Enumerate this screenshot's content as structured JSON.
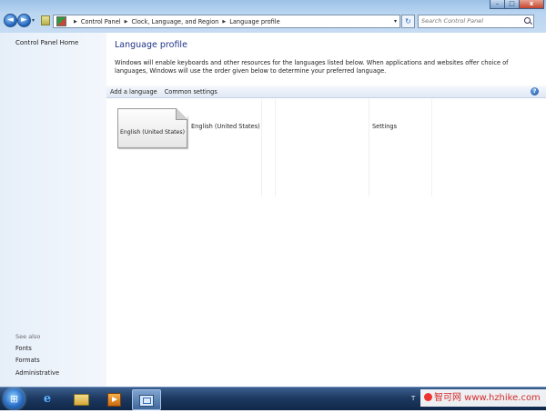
{
  "address_bar": {
    "crumbs": [
      "Control Panel",
      "Clock, Language, and Region",
      "Language profile"
    ],
    "back_glyph": "◄",
    "forward_glyph": "►",
    "dropdown_glyph": "▾",
    "refresh_glyph": "↻"
  },
  "search": {
    "placeholder": "Search Control Panel"
  },
  "window_buttons": {
    "minimize": "–",
    "maximize": "□",
    "close": "x"
  },
  "left_pane": {
    "home_link": "Control Panel Home",
    "see_also_heading": "See also",
    "see_also_links": [
      "Fonts",
      "Formats",
      "Administrative"
    ]
  },
  "main": {
    "title": "Language profile",
    "description": "Windows will enable keyboards and other resources for the languages listed below. When applications and websites offer choice of languages, Windows will use the order given below to determine your preferred language.",
    "toolbar": {
      "add_language": "Add a language",
      "common_settings": "Common settings",
      "help_glyph": "?"
    },
    "languages": [
      {
        "tile_label": "English (United States)",
        "name": "English (United States)",
        "settings_label": "Settings"
      }
    ]
  },
  "taskbar": {
    "start_glyph": "⊞",
    "items": [
      "internet-explorer-icon",
      "windows-explorer-icon",
      "media-player-icon",
      "control-panel-icon"
    ],
    "ie_glyph": "e",
    "tray_text": "T"
  },
  "watermark": {
    "text": "智可网 www.hzhike.com"
  },
  "colors": {
    "title_link": "#1e3287",
    "titlebar": "#b9d5f1",
    "taskbar": "#1e3a62",
    "close_button": "#c4432c"
  }
}
